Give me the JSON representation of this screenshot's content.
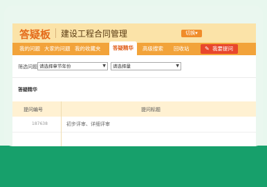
{
  "header": {
    "logo": "答疑板",
    "title": "建设工程合同管理",
    "switch_label": "切换▾"
  },
  "nav": {
    "tabs": [
      "我的问题",
      "大家的问题",
      "我的收藏夹",
      "答疑精华",
      "高级搜索",
      "回收站"
    ],
    "active": "答疑精华",
    "ask_label": "我要提问"
  },
  "filter": {
    "label": "筛选问题",
    "year_select": "请选择章节年份",
    "quantity_select": "请选择量"
  },
  "section": {
    "title": "答疑精华"
  },
  "table": {
    "headers": [
      "提问编号",
      "提问标题"
    ],
    "rows": [
      {
        "number": "187638",
        "title": "初步评审、详细评审"
      }
    ]
  }
}
